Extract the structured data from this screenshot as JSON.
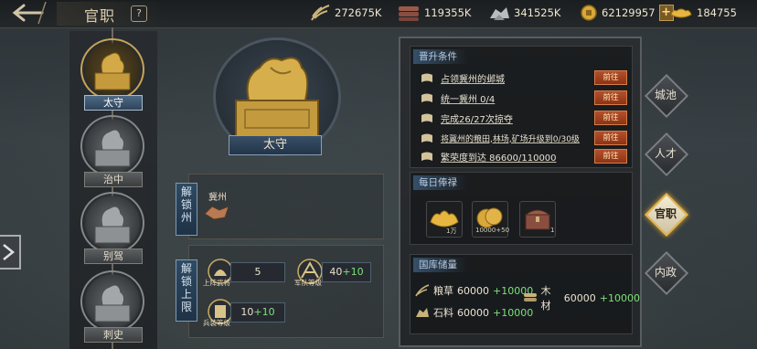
{
  "header": {
    "title": "官职",
    "help_label": "?",
    "resources": [
      {
        "icon": "grain-icon",
        "value": "272675K"
      },
      {
        "icon": "wood-icon",
        "value": "119355K"
      },
      {
        "icon": "stone-icon",
        "value": "341525K"
      },
      {
        "icon": "gold-coin-icon",
        "value": "62129957"
      },
      {
        "icon": "gold-ingot-icon",
        "value": "184755"
      }
    ],
    "plus_label": "+"
  },
  "ranks": [
    {
      "label": "太守",
      "selected": true
    },
    {
      "label": "治中",
      "selected": false
    },
    {
      "label": "别驾",
      "selected": false
    },
    {
      "label": "刺史",
      "selected": false
    }
  ],
  "current_rank": {
    "name": "太守"
  },
  "unlock_state": {
    "tab_label": "解锁州",
    "state_name": "冀州"
  },
  "unlock_limit": {
    "tab_label": "解锁上限",
    "stats": [
      {
        "caption": "上阵武将",
        "base": "5",
        "bonus": ""
      },
      {
        "caption": "军队等级",
        "base": "40",
        "bonus": "+10"
      },
      {
        "caption": "兵装等级",
        "base": "10",
        "bonus": "+10"
      }
    ]
  },
  "promotion": {
    "heading": "晋升条件",
    "go_label": "前往",
    "conditions": [
      "占领冀州的邺城",
      "统一冀州 0/4",
      "完成26/27次掠夺",
      "将冀州的粮田,林场,矿场升级到0/30级",
      "繁荣度到达 86600/110000"
    ]
  },
  "daily_salary": {
    "heading": "每日俸禄",
    "items": [
      {
        "icon": "gold-ingot-icon",
        "amount": "1万"
      },
      {
        "icon": "gold-coin-icon",
        "amount": "10000+50"
      },
      {
        "icon": "treasure-chest-icon",
        "amount": "1"
      }
    ]
  },
  "treasury": {
    "heading": "国库储量",
    "items": [
      {
        "icon": "grain-icon",
        "label": "粮草",
        "base": "60000",
        "bonus": "+10000"
      },
      {
        "icon": "wood-icon",
        "label": "木材",
        "base": "60000",
        "bonus": "+10000"
      },
      {
        "icon": "stone-icon",
        "label": "石料",
        "base": "60000",
        "bonus": "+10000"
      }
    ]
  },
  "side_tabs": [
    {
      "label": "城池",
      "active": false
    },
    {
      "label": "人才",
      "active": false
    },
    {
      "label": "官职",
      "active": true
    },
    {
      "label": "内政",
      "active": false
    }
  ],
  "colors": {
    "accent_gold": "#c8a456",
    "go_button": "#b4502a",
    "bonus_green": "#7ee07a",
    "rank_blue": "#395067"
  }
}
